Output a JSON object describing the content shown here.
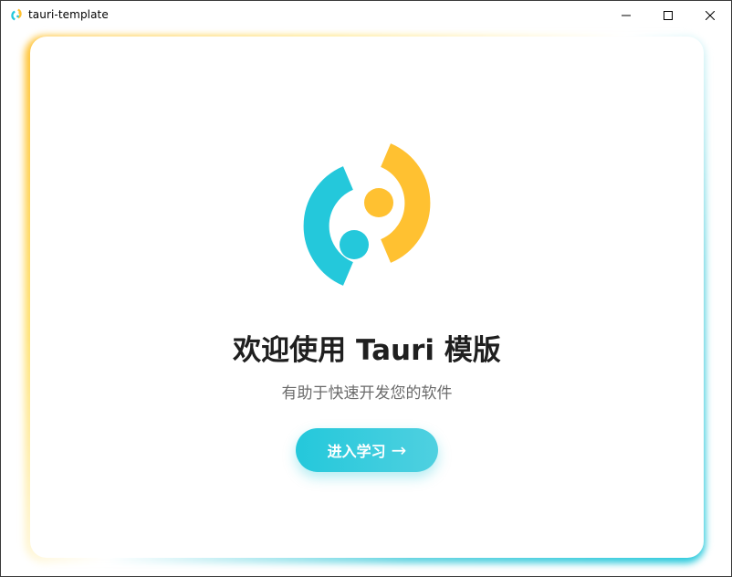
{
  "window": {
    "title": "tauri-template",
    "app_icon": "tauri-logo-icon",
    "controls": [
      "minimize-icon",
      "maximize-icon",
      "close-icon"
    ]
  },
  "main": {
    "logo": "tauri-logo",
    "headline": "欢迎使用 Tauri 模版",
    "subtitle": "有助于快速开发您的软件",
    "cta_label": "进入学习",
    "cta_arrow": "→"
  },
  "colors": {
    "tauri_cyan": "#24c8db",
    "tauri_yellow": "#ffc131",
    "headline": "#1f1f1f",
    "subtitle": "#6b6b6b"
  }
}
